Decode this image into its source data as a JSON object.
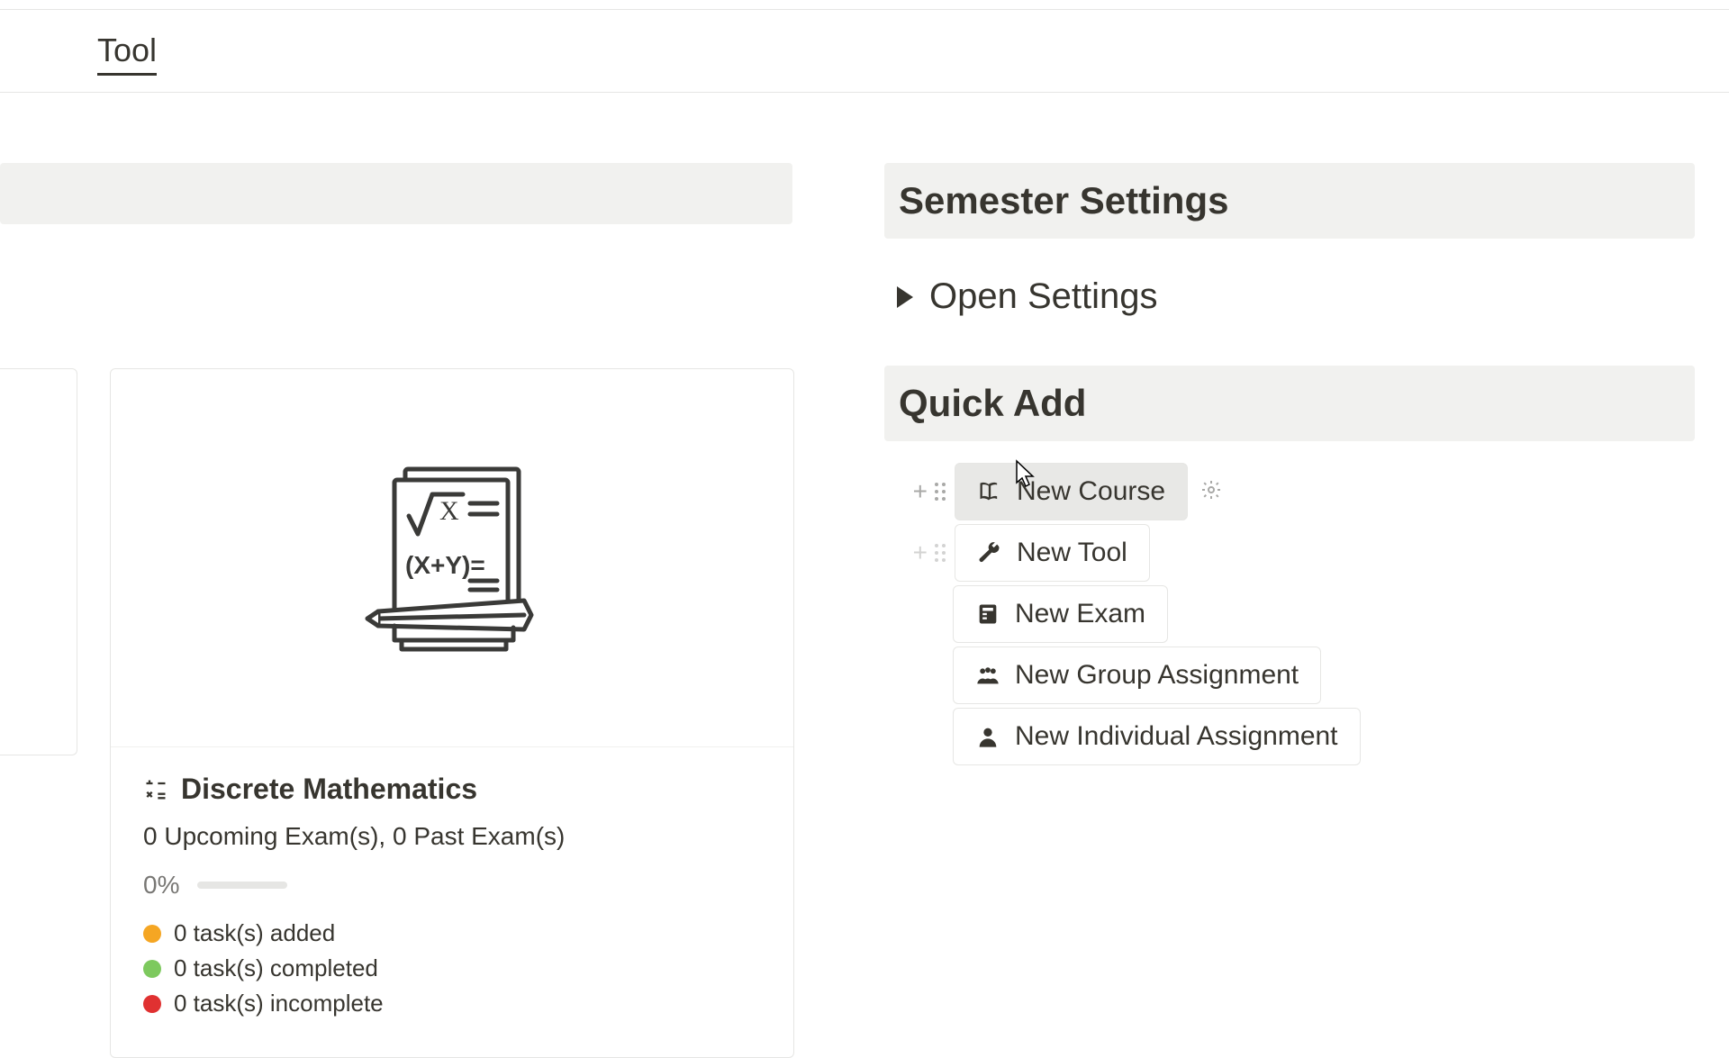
{
  "tab": {
    "label": "Tool"
  },
  "course": {
    "title": "Discrete Mathematics",
    "exam_info": "0 Upcoming Exam(s), 0 Past Exam(s)",
    "progress_percent": "0%",
    "tasks": {
      "added": "0 task(s) added",
      "completed": "0 task(s) completed",
      "incomplete": "0 task(s) incomplete"
    }
  },
  "right": {
    "semester_settings_title": "Semester Settings",
    "open_settings_label": "Open Settings",
    "quick_add_title": "Quick Add",
    "items": {
      "new_course": "New Course",
      "new_tool": "New Tool",
      "new_exam": "New Exam",
      "new_group_assignment": "New Group Assignment",
      "new_individual_assignment": "New Individual Assignment"
    }
  },
  "colors": {
    "orange": "#f5a623",
    "green": "#7dc95e",
    "red": "#e03131"
  }
}
